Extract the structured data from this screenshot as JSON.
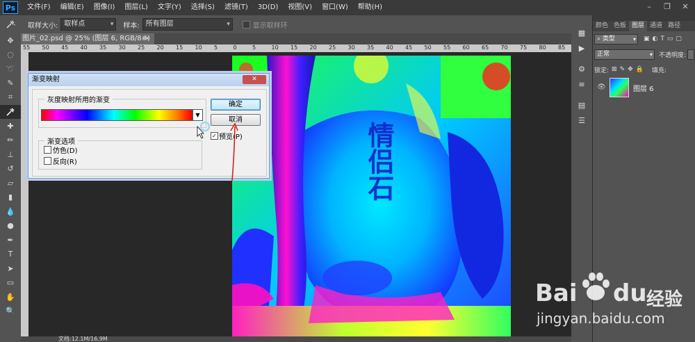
{
  "app": {
    "logo": "Ps"
  },
  "menu": [
    "文件(F)",
    "编辑(E)",
    "图像(I)",
    "图层(L)",
    "文字(Y)",
    "选择(S)",
    "滤镜(T)",
    "3D(D)",
    "视图(V)",
    "窗口(W)",
    "帮助(H)"
  ],
  "window_controls": {
    "minimize": "–",
    "restore": "❐",
    "close": "✕"
  },
  "options": {
    "sample_size_label": "取样大小:",
    "sample_size_value": "取样点",
    "sample_label": "样本:",
    "sample_value": "所有图层",
    "show_ring_label": "显示取样环"
  },
  "document": {
    "tab_title": "图片_02.psd @ 25% (图层 6, RGB/8#)",
    "close": "×",
    "status": "文档:12.1M/16.9M"
  },
  "ruler": {
    "ticks": [
      "55",
      "50",
      "45",
      "40",
      "35",
      "30",
      "25",
      "20",
      "15",
      "10",
      "5",
      "0",
      "5",
      "10",
      "15",
      "20",
      "25",
      "30",
      "35",
      "40",
      "45",
      "50",
      "55",
      "60",
      "65",
      "70",
      "75",
      "80",
      "85"
    ]
  },
  "dialog": {
    "title": "渐变映射",
    "close": "✕",
    "gradient_group_label": "灰度映射所用的渐变",
    "gradient_dropdown": "▼",
    "options_group_label": "渐变选项",
    "dither_label": "仿色(D)",
    "reverse_label": "反向(R)",
    "ok_label": "确定",
    "cancel_label": "取消",
    "preview_label": "预览(P)",
    "preview_checked": "✓"
  },
  "image": {
    "carved_text": "情侣石"
  },
  "layers_panel": {
    "tabs": [
      "颜色",
      "色板",
      "图层",
      "通道",
      "路径"
    ],
    "active_tab": "图层",
    "filter_kind": "类型",
    "blend_mode": "正常",
    "opacity_label": "不透明度:",
    "lock_label": "锁定:",
    "fill_label": "填充:",
    "layer_name": "图层 6"
  },
  "watermark": {
    "brand": "Bai",
    "brand2": "du",
    "jingyan": "经验",
    "url": "jingyan.baidu.com"
  }
}
